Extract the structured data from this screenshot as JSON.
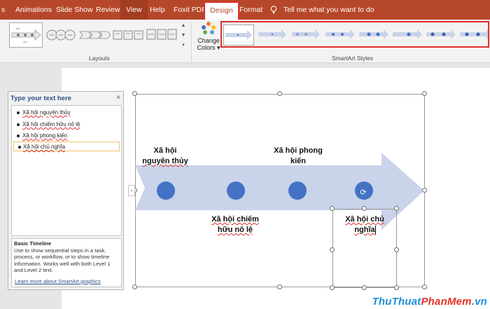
{
  "tabs": [
    {
      "label": "s"
    },
    {
      "label": "Animations"
    },
    {
      "label": "Slide Show"
    },
    {
      "label": "Review"
    },
    {
      "label": "View"
    },
    {
      "label": "Help"
    },
    {
      "label": "Foxit PDF"
    },
    {
      "label": "Design"
    },
    {
      "label": "Format"
    }
  ],
  "tell_me": "Tell me what you want to do",
  "ribbon": {
    "layouts_label": "Layouts",
    "styles_label": "SmartArt Styles",
    "change_colors": {
      "line1": "Change",
      "line2": "Colors ▾"
    }
  },
  "text_pane": {
    "title": "Type your text here",
    "close": "×",
    "items": [
      {
        "text": "Xã hội nguyên thủy"
      },
      {
        "text": "Xã hội chiếm hữu nô lệ"
      },
      {
        "text": "Xã hội phong kiến"
      },
      {
        "text": "Xã hội chủ nghĩa"
      }
    ],
    "desc_title": "Basic Timeline",
    "desc_body": "Use to show sequential steps in a task, process, or workflow, or to show timeline information. Works well with both Level 1 and Level 2 text.",
    "learn_more": "Learn more about SmartArt graphics"
  },
  "smartart": {
    "labels": [
      {
        "line1": "Xã hội",
        "line2": "nguyên thủy"
      },
      {
        "line1": "Xã hội chiếm",
        "line2": "hữu nô lệ"
      },
      {
        "line1": "Xã hội phong",
        "line2": "kiến"
      },
      {
        "line1": "Xã hội chủ",
        "line2": "nghĩa"
      }
    ],
    "colors": {
      "arrow": "#c9d3ea",
      "circle": "#4472c4"
    }
  },
  "watermark": {
    "part1": "ThuThuat",
    "part2": "PhanMem",
    "part3": ".vn"
  },
  "colors": {
    "tab_bar": "#b7472a",
    "highlight": "#e0302a"
  }
}
